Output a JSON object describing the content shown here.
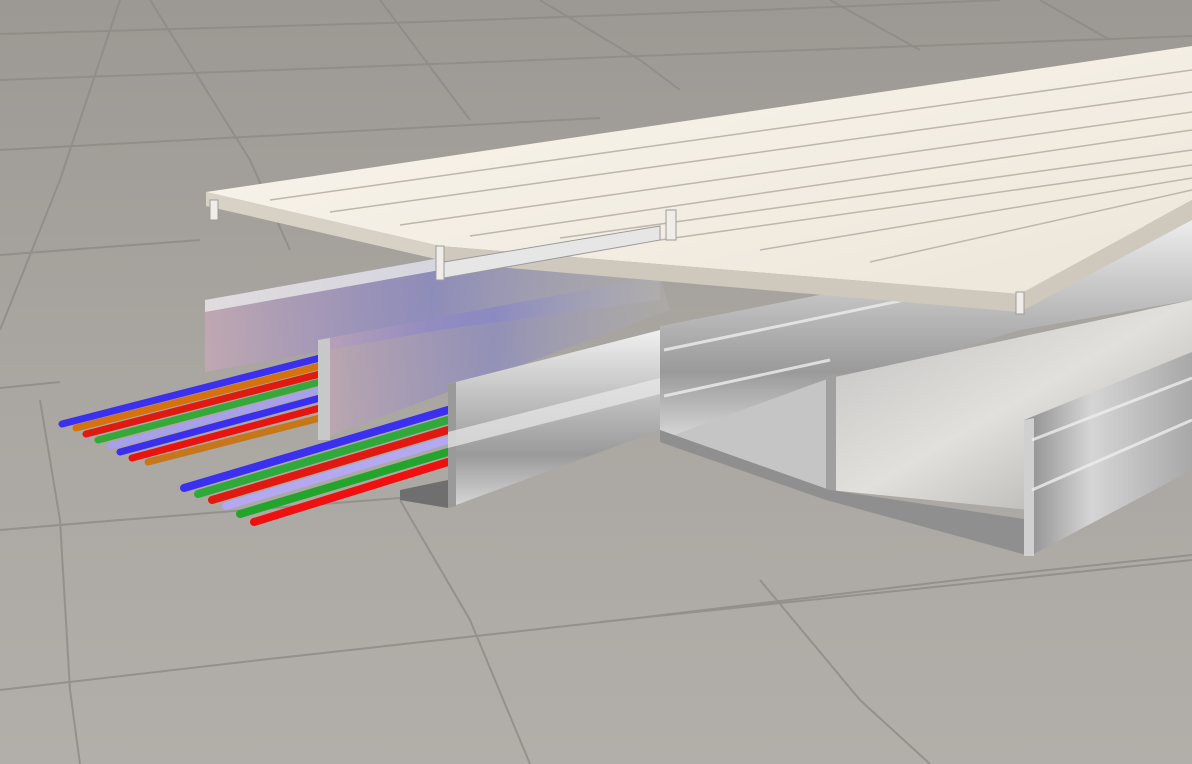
{
  "scene": {
    "subject": "cable-trunking-render",
    "floor_color": "#aaa6a1",
    "floor_grout_color": "#8e8a86",
    "lid_color": "#f3ede3",
    "lid_shadow_color": "#c9c2b7",
    "metal_light": "#e6e6e6",
    "metal_mid": "#b8b8b8",
    "metal_dark": "#7d7d7d",
    "cable_colors": [
      "#2f2cf0",
      "#e01010",
      "#2aa82a",
      "#c07a20",
      "#b5a8f0",
      "#3355ff"
    ]
  }
}
